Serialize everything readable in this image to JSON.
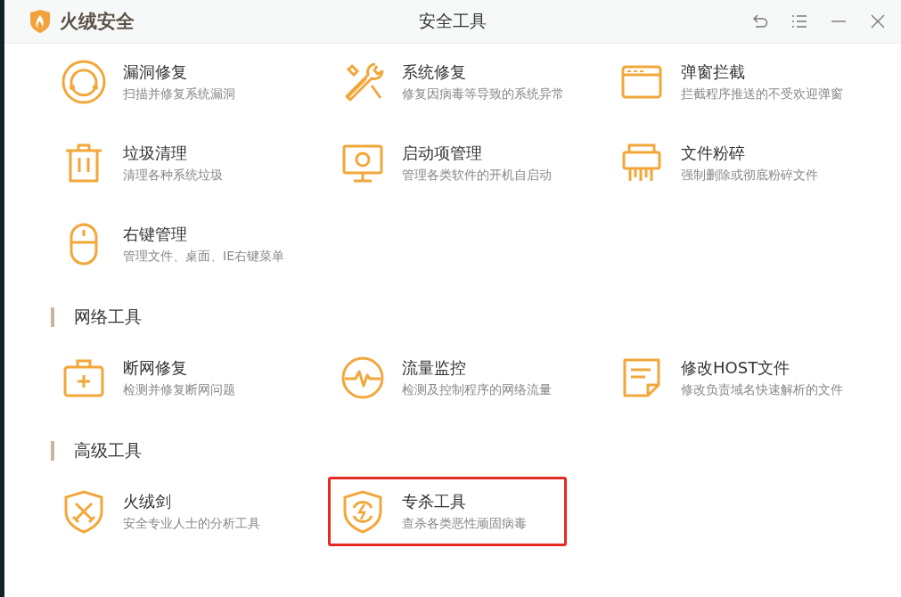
{
  "window": {
    "app_name": "火绒安全",
    "title": "安全工具"
  },
  "sections": [
    {
      "items": [
        {
          "name": "漏洞修复",
          "desc": "扫描并修复系统漏洞",
          "highlighted": false
        },
        {
          "name": "系统修复",
          "desc": "修复因病毒等导致的系统异常",
          "highlighted": false
        },
        {
          "name": "弹窗拦截",
          "desc": "拦截程序推送的不受欢迎弹窗",
          "highlighted": false
        },
        {
          "name": "垃圾清理",
          "desc": "清理各种系统垃圾",
          "highlighted": false
        },
        {
          "name": "启动项管理",
          "desc": "管理各类软件的开机自启动",
          "highlighted": false
        },
        {
          "name": "文件粉碎",
          "desc": "强制删除或彻底粉碎文件",
          "highlighted": false
        },
        {
          "name": "右键管理",
          "desc": "管理文件、桌面、IE右键菜单",
          "highlighted": false
        }
      ]
    },
    {
      "title": "网络工具",
      "items": [
        {
          "name": "断网修复",
          "desc": "检测并修复断网问题",
          "highlighted": false
        },
        {
          "name": "流量监控",
          "desc": "检测及控制程序的网络流量",
          "highlighted": false
        },
        {
          "name": "修改HOST文件",
          "desc": "修改负责域名快速解析的文件",
          "highlighted": false
        }
      ]
    },
    {
      "title": "高级工具",
      "items": [
        {
          "name": "火绒剑",
          "desc": "安全专业人士的分析工具",
          "highlighted": false
        },
        {
          "name": "专杀工具",
          "desc": "查杀各类恶性顽固病毒",
          "highlighted": true
        }
      ]
    }
  ]
}
